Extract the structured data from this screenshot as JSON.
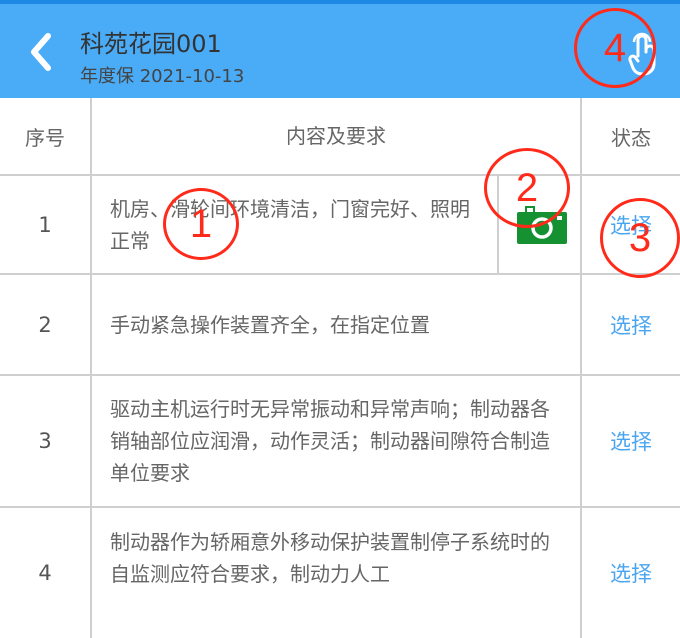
{
  "header": {
    "title": "科苑花园001",
    "subtitle": "年度保 2021-10-13",
    "back_icon": "chevron-left-icon",
    "action_icon": "hand-tap-icon",
    "color": "#4aabf7"
  },
  "table": {
    "columns": [
      "序号",
      "内容及要求",
      "状态"
    ],
    "rows": [
      {
        "no": "1",
        "content": "机房、滑轮间环境清洁，门窗完好、照明正常",
        "status": "选择",
        "has_camera": true
      },
      {
        "no": "2",
        "content": "手动紧急操作装置齐全，在指定位置",
        "status": "选择"
      },
      {
        "no": "3",
        "content": "驱动主机运行时无异常振动和异常声响；制动器各销轴部位应润滑，动作灵活；制动器间隙符合制造单位要求",
        "status": "选择"
      },
      {
        "no": "4",
        "content": "制动器作为轿厢意外移动保护装置制停子系统时的自监测应符合要求，制动力人工",
        "status": "选择"
      }
    ],
    "link_color": "#4aa5f0",
    "camera_color": "#169131"
  },
  "annotations": [
    "1",
    "2",
    "3",
    "4"
  ]
}
